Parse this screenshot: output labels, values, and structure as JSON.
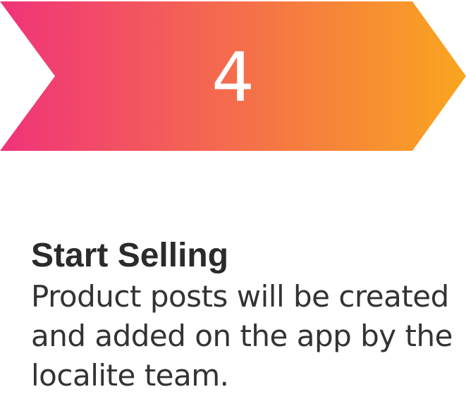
{
  "step": {
    "number": "4",
    "title": "Start Selling",
    "description": "Product posts will be created and added on the app by the localite team.",
    "colors": {
      "gradient_start": "#f0337a",
      "gradient_end": "#f9a61f",
      "number_text": "#ffffff",
      "title_text": "#2b2b2b",
      "description_text": "#333333"
    }
  }
}
